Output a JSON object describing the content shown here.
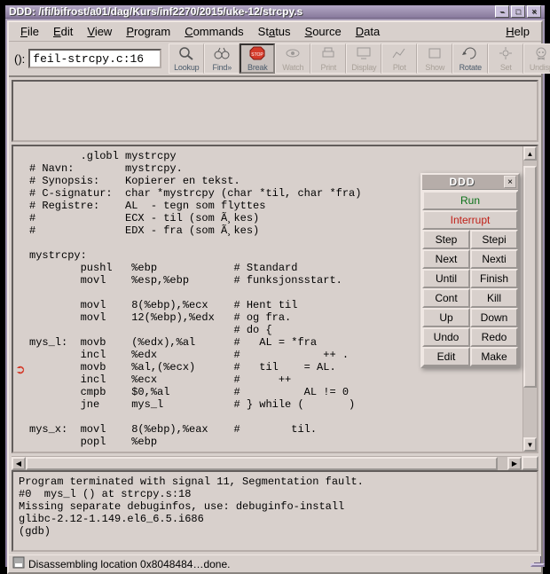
{
  "window": {
    "title": "DDD: /ifi/bifrost/a01/dag/Kurs/inf2270/2015/uke-12/strcpy.s",
    "controls": {
      "minimize": "–",
      "maximize": "□",
      "close": "×"
    }
  },
  "menubar": {
    "items": [
      "File",
      "Edit",
      "View",
      "Program",
      "Commands",
      "Status",
      "Source",
      "Data"
    ],
    "right": "Help"
  },
  "toolbar": {
    "prefix": "():",
    "location": "feil-strcpy.c:16",
    "buttons": [
      {
        "id": "lookup",
        "label": "Lookup",
        "enabled": true
      },
      {
        "id": "findfwd",
        "label": "Find»",
        "enabled": true
      },
      {
        "id": "break",
        "label": "Break",
        "enabled": true,
        "active": true
      },
      {
        "id": "watch",
        "label": "Watch",
        "enabled": false
      },
      {
        "id": "print",
        "label": "Print",
        "enabled": false
      },
      {
        "id": "display",
        "label": "Display",
        "enabled": false
      },
      {
        "id": "plot",
        "label": "Plot",
        "enabled": false
      },
      {
        "id": "show",
        "label": "Show",
        "enabled": false
      },
      {
        "id": "rotate",
        "label": "Rotate",
        "enabled": true
      },
      {
        "id": "set",
        "label": "Set",
        "enabled": false
      },
      {
        "id": "undisp",
        "label": "Undisp",
        "enabled": false
      }
    ]
  },
  "command_tool": {
    "title": "DDD",
    "rows": [
      [
        {
          "label": "Run",
          "style": "green"
        }
      ],
      [
        {
          "label": "Interrupt",
          "style": "red"
        }
      ],
      [
        {
          "label": "Step"
        },
        {
          "label": "Stepi"
        }
      ],
      [
        {
          "label": "Next"
        },
        {
          "label": "Nexti"
        }
      ],
      [
        {
          "label": "Until"
        },
        {
          "label": "Finish"
        }
      ],
      [
        {
          "label": "Cont"
        },
        {
          "label": "Kill"
        }
      ],
      [
        {
          "label": "Up"
        },
        {
          "label": "Down"
        }
      ],
      [
        {
          "label": "Undo"
        },
        {
          "label": "Redo"
        }
      ],
      [
        {
          "label": "Edit"
        },
        {
          "label": "Make"
        }
      ]
    ]
  },
  "source": {
    "text": "        .globl mystrcpy\n# Navn:        mystrcpy.\n# Synopsis:    Kopierer en tekst.\n# C-signatur:  char *mystrcpy (char *til, char *fra)\n# Registre:    AL  - tegn som flyttes\n#              ECX - til (som Ã¸kes)\n#              EDX - fra (som Ã¸kes)\n\nmystrcpy:\n        pushl   %ebp            # Standard\n        movl    %esp,%ebp       # funksjonsstart.\n\n        movl    8(%ebp),%ecx    # Hent til\n        movl    12(%ebp),%edx   # og fra.\n                                # do {\nmys_l:  movb    (%edx),%al      #   AL = *fra\n        incl    %edx            #             ++ .\n        movb    %al,(%ecx)      #   til    = AL.\n        incl    %ecx            #      ++\n        cmpb    $0,%al          #          AL != 0\n        jne     mys_l           # } while (       )\n\nmys_x:  movl    8(%ebp),%eax    #        til.\n        popl    %ebp",
    "breakpoint_glyph": "➲"
  },
  "console": {
    "text": "Program terminated with signal 11, Segmentation fault.\n#0  mys_l () at strcpy.s:18\nMissing separate debuginfos, use: debuginfo-install \nglibc-2.12-1.149.el6_6.5.i686\n(gdb) "
  },
  "status": {
    "text": "Disassembling location 0x8048484…done."
  }
}
